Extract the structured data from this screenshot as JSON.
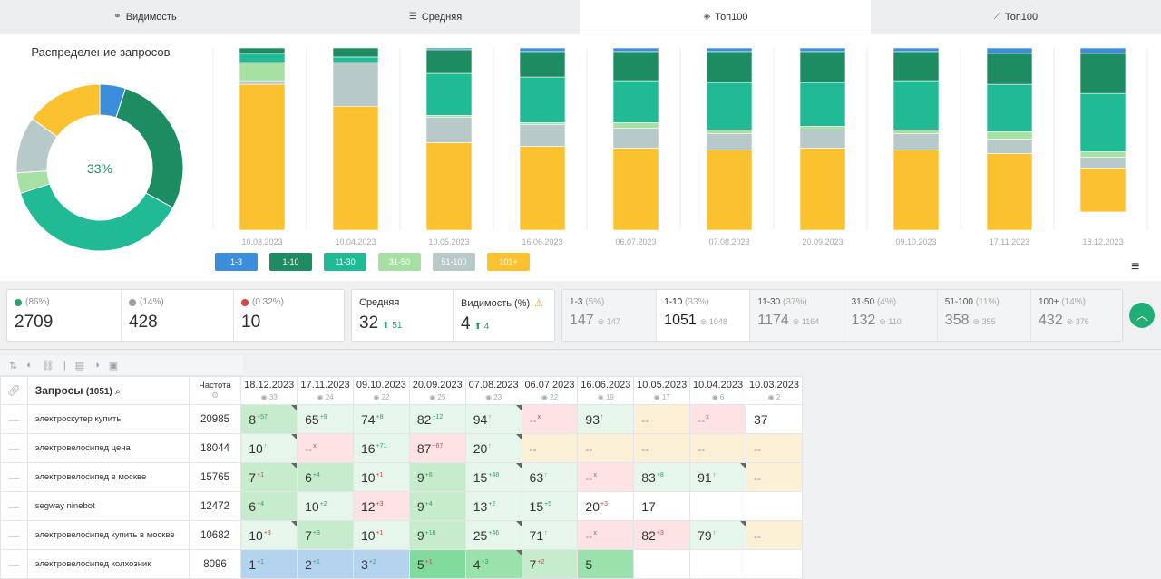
{
  "tabs": [
    {
      "label": "Видимость",
      "icon": "binoculars-icon"
    },
    {
      "label": "Средняя",
      "icon": "list-icon"
    },
    {
      "label": "Топ100",
      "icon": "layers-icon",
      "active": true
    },
    {
      "label": "Топ100",
      "icon": "trend-icon"
    }
  ],
  "donut": {
    "title": "Распределение запросов",
    "center_label": "33%"
  },
  "chart_data": {
    "type": "bar",
    "stacked": true,
    "categories": [
      "10.03.2023",
      "10.04.2023",
      "10.05.2023",
      "16.06.2023",
      "06.07.2023",
      "07.08.2023",
      "20.09.2023",
      "09.10.2023",
      "17.11.2023",
      "18.12.2023"
    ],
    "series": [
      {
        "name": "1-3",
        "color": "#3a8edb",
        "values": [
          0,
          0,
          1,
          2,
          2,
          2,
          2,
          2,
          3,
          3
        ]
      },
      {
        "name": "1-10",
        "color": "#1e8c63",
        "values": [
          3,
          5,
          13,
          14,
          16,
          17,
          17,
          16,
          17,
          22
        ]
      },
      {
        "name": "11-30",
        "color": "#20bb94",
        "values": [
          5,
          3,
          23,
          25,
          23,
          26,
          24,
          27,
          26,
          32
        ]
      },
      {
        "name": "31-50",
        "color": "#a7e0a3",
        "values": [
          10,
          0,
          1,
          1,
          3,
          2,
          2,
          2,
          4,
          3
        ]
      },
      {
        "name": "51-100",
        "color": "#b7c9c9",
        "values": [
          2,
          24,
          14,
          12,
          11,
          9,
          10,
          9,
          8,
          6
        ]
      },
      {
        "name": "101+",
        "color": "#fbc12e",
        "values": [
          80,
          68,
          48,
          46,
          45,
          44,
          45,
          44,
          42,
          24
        ]
      }
    ],
    "ylim": [
      0,
      100
    ],
    "grid": true,
    "legend": "bottom-left"
  },
  "donut_data": [
    {
      "name": "1-3",
      "color": "#3a8edb",
      "value": 5
    },
    {
      "name": "1-10",
      "color": "#1e8c63",
      "value": 28
    },
    {
      "name": "11-30",
      "color": "#20bb94",
      "value": 37
    },
    {
      "name": "31-50",
      "color": "#a7e0a3",
      "value": 4
    },
    {
      "name": "51-100",
      "color": "#b7c9c9",
      "value": 11
    },
    {
      "name": "101+",
      "color": "#fbc12e",
      "value": 15
    }
  ],
  "stats": {
    "up": {
      "pct": "(86%)",
      "value": "2709"
    },
    "same": {
      "pct": "(14%)",
      "value": "428"
    },
    "down": {
      "pct": "(0.32%)",
      "value": "10"
    },
    "avg": {
      "label": "Средняя",
      "value": "32",
      "delta": "51"
    },
    "visibility": {
      "label": "Видимость (%)",
      "value": "4",
      "delta": "4"
    }
  },
  "buckets": [
    {
      "title": "1-3",
      "pct": "(5%)",
      "value": "147",
      "prev": "147",
      "active": false
    },
    {
      "title": "1-10",
      "pct": "(33%)",
      "value": "1051",
      "prev": "1048",
      "active": true
    },
    {
      "title": "11-30",
      "pct": "(37%)",
      "value": "1174",
      "prev": "1164",
      "active": false
    },
    {
      "title": "31-50",
      "pct": "(4%)",
      "value": "132",
      "prev": "110",
      "active": false
    },
    {
      "title": "51-100",
      "pct": "(11%)",
      "value": "358",
      "prev": "355",
      "active": false
    },
    {
      "title": "100+",
      "pct": "(14%)",
      "value": "432",
      "prev": "376",
      "active": false
    }
  ],
  "table": {
    "query_header": "Запросы",
    "query_count": "(1051)",
    "freq_header": "Частота",
    "dates": [
      {
        "date": "18.12.2023",
        "vis": "33"
      },
      {
        "date": "17.11.2023",
        "vis": "24"
      },
      {
        "date": "09.10.2023",
        "vis": "22"
      },
      {
        "date": "20.09.2023",
        "vis": "25"
      },
      {
        "date": "07.08.2023",
        "vis": "23"
      },
      {
        "date": "06.07.2023",
        "vis": "22"
      },
      {
        "date": "16.06.2023",
        "vis": "19"
      },
      {
        "date": "10.05.2023",
        "vis": "17"
      },
      {
        "date": "10.04.2023",
        "vis": "6"
      },
      {
        "date": "10.03.2023",
        "vis": "2"
      }
    ],
    "rows": [
      {
        "query": "электроскутер купить",
        "freq": "20985",
        "cells": [
          {
            "v": "8",
            "d": "+57",
            "c": "#c7eccd",
            "k": "up",
            "corner": true
          },
          {
            "v": "65",
            "d": "+9",
            "c": "#e7f6ea",
            "k": "up"
          },
          {
            "v": "74",
            "d": "+8",
            "c": "#e7f6ea",
            "k": "up"
          },
          {
            "v": "82",
            "d": "+12",
            "c": "#e7f6ea",
            "k": "up"
          },
          {
            "v": "94",
            "d": "↑",
            "c": "#e7f6ea",
            "k": "up",
            "corner": true
          },
          {
            "v": "--",
            "d": "x",
            "c": "#fde3e3",
            "k": "gr"
          },
          {
            "v": "93",
            "d": "↑",
            "c": "#e7f6ea",
            "k": "up"
          },
          {
            "v": "--",
            "d": "",
            "c": "#fbf0d6",
            "k": ""
          },
          {
            "v": "--",
            "d": "x",
            "c": "#fde3e3",
            "k": "gr"
          },
          {
            "v": "37",
            "d": "",
            "c": "#ffffff",
            "k": ""
          }
        ]
      },
      {
        "query": "электровелосипед цена",
        "freq": "18044",
        "cells": [
          {
            "v": "10",
            "d": "↑",
            "c": "#e7f6ea",
            "k": "up",
            "corner": true
          },
          {
            "v": "--",
            "d": "x",
            "c": "#fde3e3",
            "k": "gr"
          },
          {
            "v": "16",
            "d": "+71",
            "c": "#e7f6ea",
            "k": "up"
          },
          {
            "v": "87",
            "d": "+67",
            "c": "#fde3e3",
            "k": "dn"
          },
          {
            "v": "20",
            "d": "↑",
            "c": "#e7f6ea",
            "k": "up",
            "corner": true
          },
          {
            "v": "--",
            "d": "",
            "c": "#fbf0d6",
            "k": ""
          },
          {
            "v": "--",
            "d": "",
            "c": "#fbf0d6",
            "k": ""
          },
          {
            "v": "--",
            "d": "",
            "c": "#fbf0d6",
            "k": ""
          },
          {
            "v": "--",
            "d": "",
            "c": "#fbf0d6",
            "k": ""
          },
          {
            "v": "--",
            "d": "",
            "c": "#fbf0d6",
            "k": ""
          }
        ]
      },
      {
        "query": "электровелосипед в москве",
        "freq": "15765",
        "cells": [
          {
            "v": "7",
            "d": "+1",
            "c": "#c7eccd",
            "k": "dn",
            "corner": true
          },
          {
            "v": "6",
            "d": "+4",
            "c": "#c7eccd",
            "k": "up"
          },
          {
            "v": "10",
            "d": "+1",
            "c": "#e7f6ea",
            "k": "dn"
          },
          {
            "v": "9",
            "d": "+6",
            "c": "#c7eccd",
            "k": "up"
          },
          {
            "v": "15",
            "d": "+48",
            "c": "#e7f6ea",
            "k": "up",
            "corner": true
          },
          {
            "v": "63",
            "d": "↑",
            "c": "#e7f6ea",
            "k": "up"
          },
          {
            "v": "--",
            "d": "x",
            "c": "#fde3e3",
            "k": "gr"
          },
          {
            "v": "83",
            "d": "+8",
            "c": "#e7f6ea",
            "k": "up"
          },
          {
            "v": "91",
            "d": "↑",
            "c": "#e7f6ea",
            "k": "up",
            "corner": true
          },
          {
            "v": "--",
            "d": "",
            "c": "#fbf0d6",
            "k": ""
          }
        ]
      },
      {
        "query": "segway ninebot",
        "freq": "12472",
        "cells": [
          {
            "v": "6",
            "d": "+4",
            "c": "#c7eccd",
            "k": "up"
          },
          {
            "v": "10",
            "d": "+2",
            "c": "#e7f6ea",
            "k": "up"
          },
          {
            "v": "12",
            "d": "+3",
            "c": "#fde3e3",
            "k": "dn"
          },
          {
            "v": "9",
            "d": "+4",
            "c": "#c7eccd",
            "k": "up"
          },
          {
            "v": "13",
            "d": "+2",
            "c": "#e7f6ea",
            "k": "up"
          },
          {
            "v": "15",
            "d": "+5",
            "c": "#e7f6ea",
            "k": "up"
          },
          {
            "v": "20",
            "d": "+3",
            "c": "#ffffff",
            "k": "dn"
          },
          {
            "v": "17",
            "d": "",
            "c": "#ffffff",
            "k": ""
          },
          {
            "v": "",
            "d": "",
            "c": "#ffffff",
            "k": ""
          },
          {
            "v": "",
            "d": "",
            "c": "#ffffff",
            "k": ""
          }
        ]
      },
      {
        "query": "электровелосипед купить в москве",
        "freq": "10682",
        "cells": [
          {
            "v": "10",
            "d": "+3",
            "c": "#e7f6ea",
            "k": "dn",
            "corner": true
          },
          {
            "v": "7",
            "d": "+3",
            "c": "#c7eccd",
            "k": "up"
          },
          {
            "v": "10",
            "d": "+1",
            "c": "#e7f6ea",
            "k": "dn"
          },
          {
            "v": "9",
            "d": "+16",
            "c": "#c7eccd",
            "k": "up"
          },
          {
            "v": "25",
            "d": "+46",
            "c": "#e7f6ea",
            "k": "up",
            "corner": true
          },
          {
            "v": "71",
            "d": "↑",
            "c": "#e7f6ea",
            "k": "up"
          },
          {
            "v": "--",
            "d": "x",
            "c": "#fde3e3",
            "k": "gr"
          },
          {
            "v": "82",
            "d": "+3",
            "c": "#fde3e3",
            "k": "dn"
          },
          {
            "v": "79",
            "d": "↑",
            "c": "#e7f6ea",
            "k": "up",
            "corner": true
          },
          {
            "v": "--",
            "d": "",
            "c": "#fbf0d6",
            "k": ""
          }
        ]
      },
      {
        "query": "электровелосипед колхозник",
        "freq": "8096",
        "cells": [
          {
            "v": "1",
            "d": "+1",
            "c": "#b3d3ef",
            "k": "up"
          },
          {
            "v": "2",
            "d": "+1",
            "c": "#b3d3ef",
            "k": "up"
          },
          {
            "v": "3",
            "d": "+2",
            "c": "#b3d3ef",
            "k": "up"
          },
          {
            "v": "5",
            "d": "+1",
            "c": "#7fdc9c",
            "k": "dn"
          },
          {
            "v": "4",
            "d": "+3",
            "c": "#9ae2ab",
            "k": "up",
            "corner": true
          },
          {
            "v": "7",
            "d": "+2",
            "c": "#c7eccd",
            "k": "dn"
          },
          {
            "v": "5",
            "d": "",
            "c": "#9ae2ab",
            "k": ""
          },
          {
            "v": "",
            "d": "",
            "c": "#ffffff",
            "k": ""
          },
          {
            "v": "",
            "d": "",
            "c": "#ffffff",
            "k": ""
          },
          {
            "v": "",
            "d": "",
            "c": "#ffffff",
            "k": ""
          }
        ]
      }
    ]
  }
}
